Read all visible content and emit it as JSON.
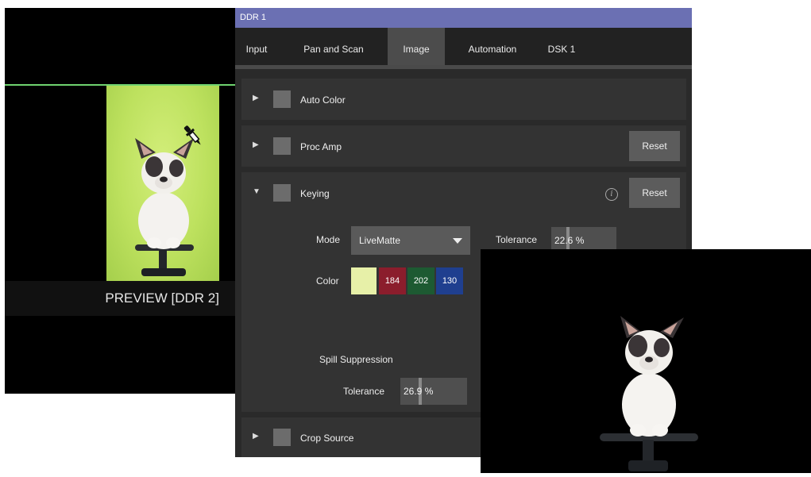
{
  "preview": {
    "label": "PREVIEW [DDR 2]"
  },
  "panel": {
    "title": "DDR 1",
    "tabs": [
      {
        "label": "Input",
        "active": false
      },
      {
        "label": "Pan and Scan",
        "active": false
      },
      {
        "label": "Image",
        "active": true
      },
      {
        "label": "Automation",
        "active": false
      },
      {
        "label": "DSK 1",
        "active": false
      }
    ],
    "sections": {
      "auto_color": {
        "title": "Auto Color",
        "expanded": false
      },
      "proc_amp": {
        "title": "Proc Amp",
        "expanded": false,
        "reset_label": "Reset"
      },
      "keying": {
        "title": "Keying",
        "expanded": true,
        "reset_label": "Reset",
        "info_glyph": "i"
      },
      "crop_source": {
        "title": "Crop Source",
        "expanded": false
      }
    },
    "keying": {
      "mode_label": "Mode",
      "mode_value": "LiveMatte",
      "tolerance_label": "Tolerance",
      "tolerance_value": "22.6 %",
      "tolerance_level": 22.6,
      "color_label": "Color",
      "color": {
        "r": "184",
        "g": "202",
        "b": "130",
        "swatch": "#e7f0a8"
      },
      "spill_label": "Spill Suppression",
      "spill_tolerance_label": "Tolerance",
      "spill_tolerance_value": "26.9 %",
      "spill_tolerance_level": 26.9
    }
  },
  "colors": {
    "title_bar": "#6b70b3",
    "preview_border": "#6fd36f",
    "green_screen": "#bde15e",
    "red_channel": "#8b1d2c",
    "green_channel": "#1d5a32",
    "blue_channel": "#1f3f8f"
  },
  "icons": [
    "eyedropper-icon",
    "expand-arrow-icon",
    "collapse-arrow-icon",
    "info-icon",
    "dropdown-caret-icon"
  ]
}
